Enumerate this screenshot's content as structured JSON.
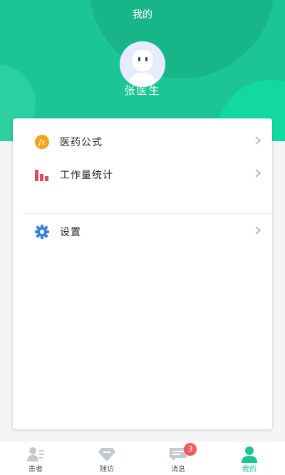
{
  "header": {
    "title": "我的"
  },
  "user": {
    "name": "张医生"
  },
  "menu": [
    {
      "label": "医药公式",
      "icon": "formula-icon",
      "icon_text": "fx"
    },
    {
      "label": "工作量统计",
      "icon": "bar-chart-icon"
    },
    {
      "label": "设置",
      "icon": "gear-icon"
    }
  ],
  "tabbar": {
    "tabs": [
      {
        "label": "患者",
        "icon": "patient-card-icon",
        "active": false
      },
      {
        "label": "随访",
        "icon": "diamond-icon",
        "active": false
      },
      {
        "label": "消息",
        "icon": "message-icon",
        "active": false,
        "badge": "3"
      },
      {
        "label": "我的",
        "icon": "person-icon",
        "active": true
      }
    ]
  },
  "colors": {
    "primary": "#1cc595",
    "badge": "#f05a5a",
    "formula_icon": "#f3a31b",
    "chart_icon": "#e04a5a",
    "gear_icon": "#3d7fe0"
  }
}
